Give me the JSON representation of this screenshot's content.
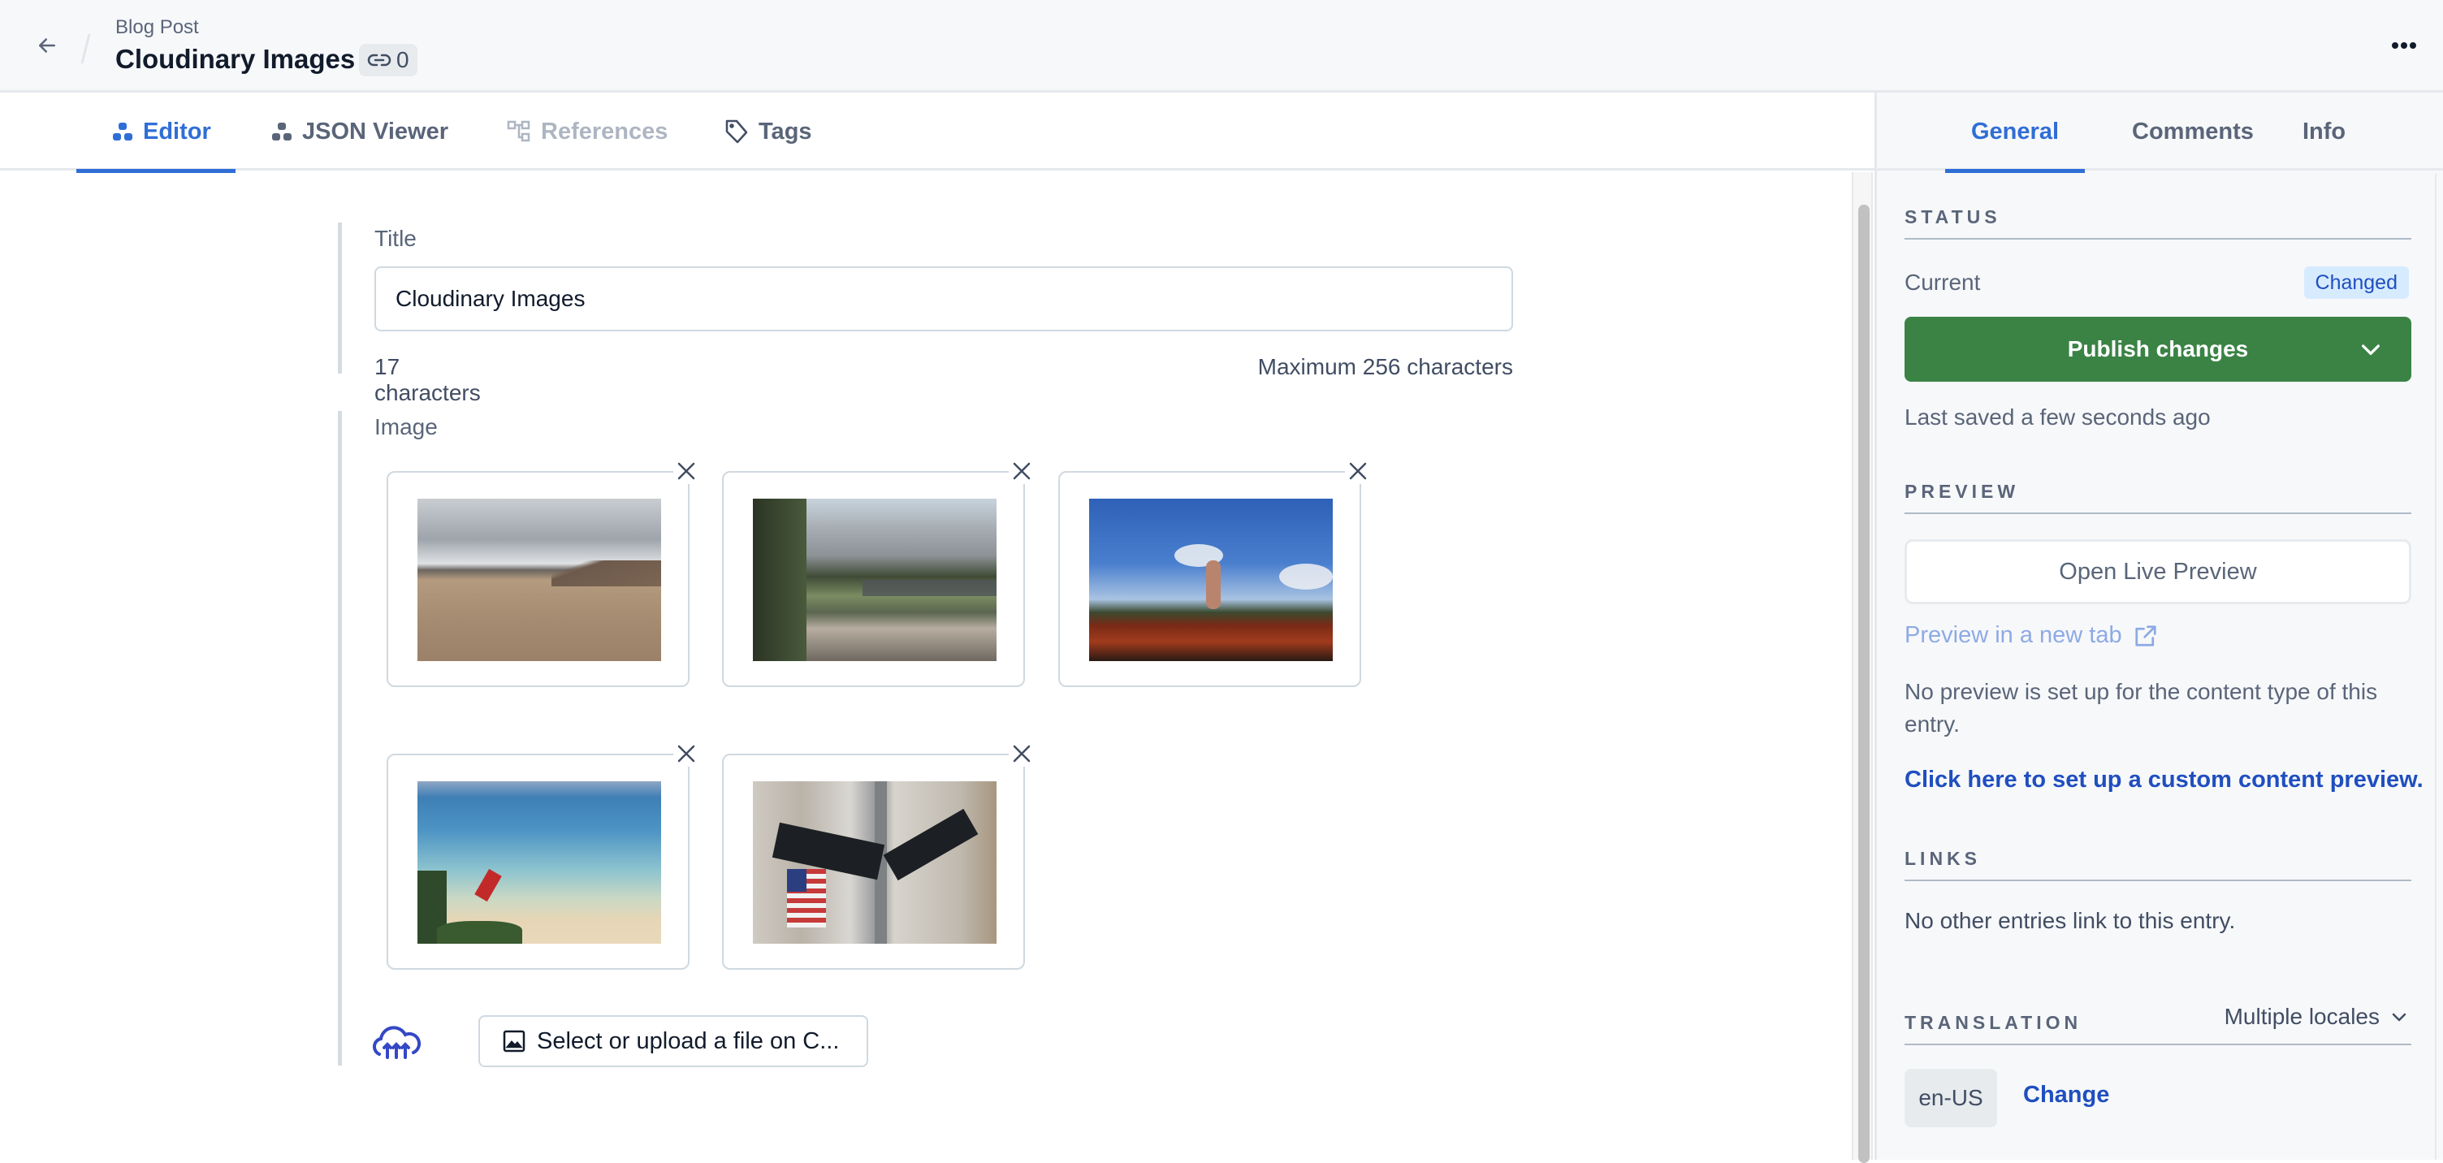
{
  "header": {
    "content_type": "Blog Post",
    "entry_title": "Cloudinary Images",
    "reference_count": "0"
  },
  "main_tabs": [
    {
      "label": "Editor",
      "icon": "editor-icon",
      "state": "active"
    },
    {
      "label": "JSON Viewer",
      "icon": "json-viewer-icon",
      "state": "normal"
    },
    {
      "label": "References",
      "icon": "references-icon",
      "state": "disabled"
    },
    {
      "label": "Tags",
      "icon": "tag-icon",
      "state": "normal"
    }
  ],
  "editor": {
    "title_field": {
      "label": "Title",
      "value": "Cloudinary Images",
      "char_count": "17 characters",
      "max_chars": "Maximum 256 characters"
    },
    "image_field": {
      "label": "Image",
      "images": [
        {
          "description": "geothermal field with clouds and mountain"
        },
        {
          "description": "forest meadow with granite cliffs"
        },
        {
          "description": "child standing on red dirt mound under blue sky"
        },
        {
          "description": "tropical beach with red boat"
        },
        {
          "description": "Broadway and Morris street signs with flag"
        }
      ],
      "upload_button": "Select or upload a file on C..."
    }
  },
  "sidebar": {
    "tabs": [
      {
        "label": "General",
        "state": "active"
      },
      {
        "label": "Comments",
        "state": "normal"
      },
      {
        "label": "Info",
        "state": "normal"
      }
    ],
    "status": {
      "heading": "STATUS",
      "current_label": "Current",
      "badge": "Changed",
      "publish_button": "Publish changes",
      "last_saved": "Last saved a few seconds ago"
    },
    "preview": {
      "heading": "PREVIEW",
      "live_preview_button": "Open Live Preview",
      "new_tab_link": "Preview in a new tab",
      "no_preview_text": "No preview is set up for the content type of this entry.",
      "setup_link": "Click here to set up a custom content preview."
    },
    "links": {
      "heading": "LINKS",
      "text": "No other entries link to this entry."
    },
    "translation": {
      "heading": "TRANSLATION",
      "mode_select": "Multiple locales",
      "locale": "en-US",
      "change_link": "Change"
    }
  },
  "colors": {
    "accent": "#2f6ed6",
    "publish": "#3a8345",
    "badge_bg": "#d7ebff",
    "link": "#1f4fbf"
  }
}
